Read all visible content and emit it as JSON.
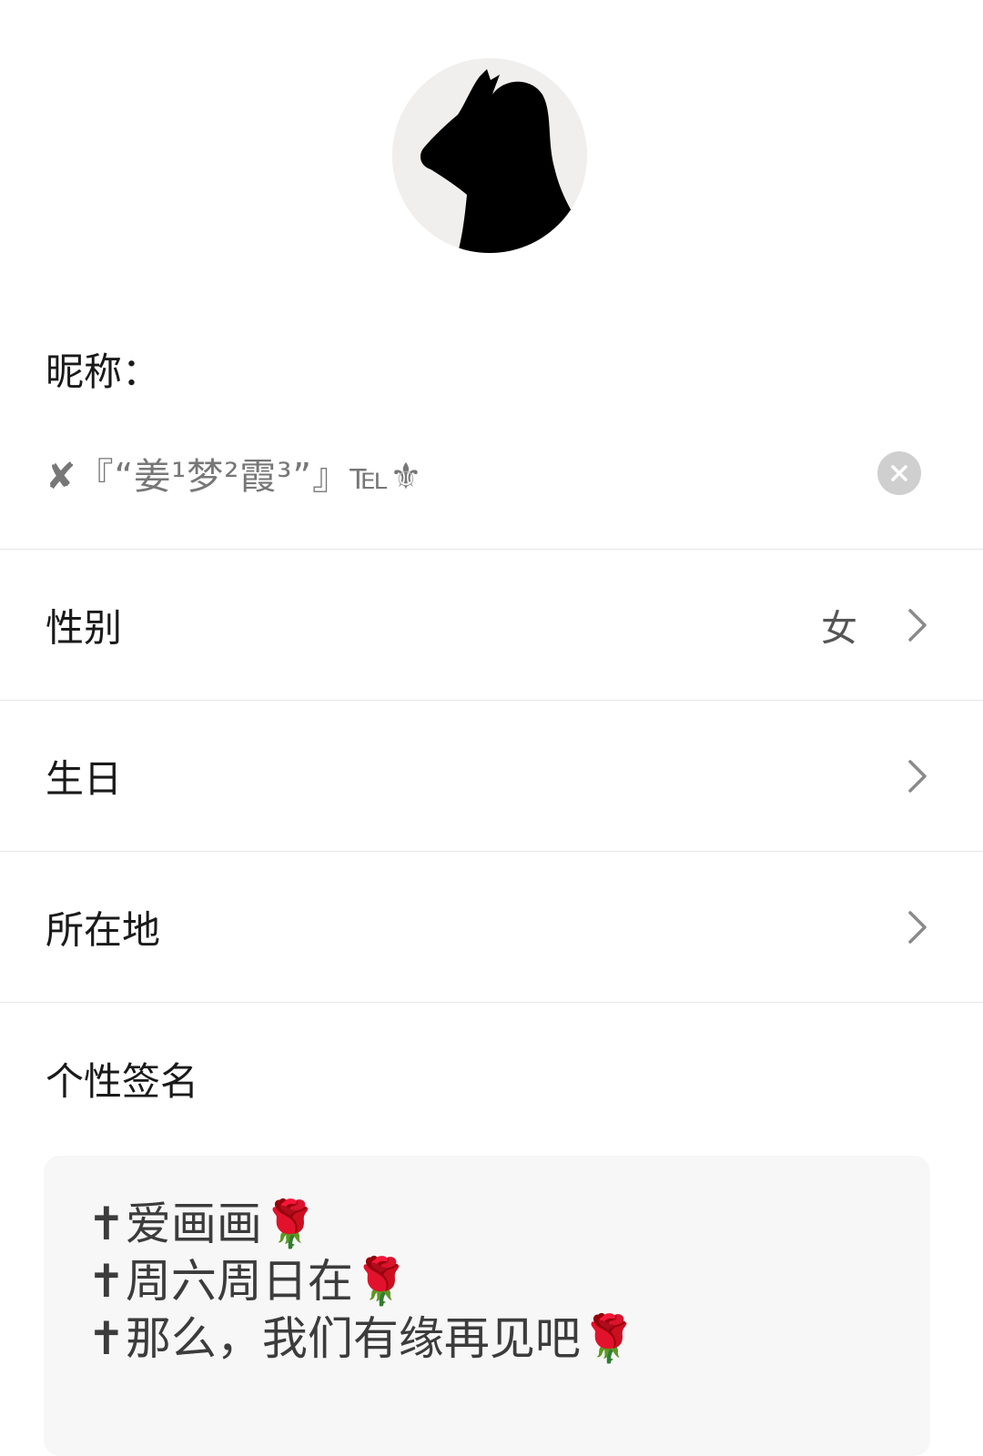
{
  "profile": {
    "avatar_icon": "silhouette-avatar",
    "nickname_label": "昵称：",
    "nickname_value": "✘『“姜¹梦²霞³”』℡⚜",
    "clear_icon": "close-circle-icon"
  },
  "fields": [
    {
      "label": "性别",
      "value": "女",
      "chevron_icon": "chevron-right-icon"
    },
    {
      "label": "生日",
      "value": "",
      "chevron_icon": "chevron-right-icon"
    },
    {
      "label": "所在地",
      "value": "",
      "chevron_icon": "chevron-right-icon"
    }
  ],
  "signature": {
    "label": "个性签名",
    "lines": [
      "✝爱画画🌹",
      "✝周六周日在🌹",
      "✝那么，我们有缘再见吧🌹"
    ]
  },
  "colors": {
    "divider": "#e6e6e6",
    "clear_button": "#cfcfcf",
    "signature_background": "#f7f7f7"
  }
}
